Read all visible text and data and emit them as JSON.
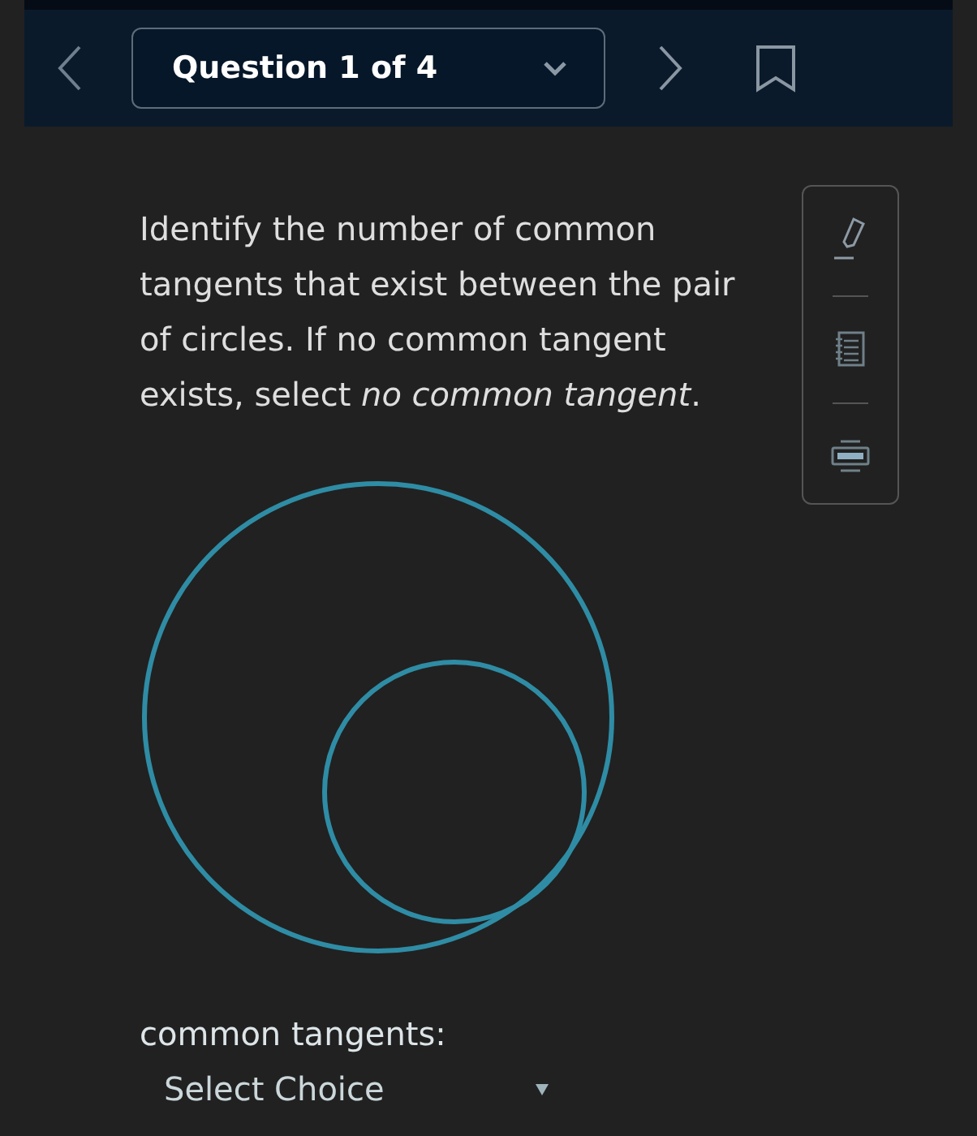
{
  "header": {
    "question_selector": "Question 1 of 4"
  },
  "question": {
    "text": "Identify the number of common tangents that exist between the pair of circles. If no common tangent exists, select *no common tangent*."
  },
  "answer": {
    "label": "common tangents:",
    "select": "Select Choice"
  }
}
